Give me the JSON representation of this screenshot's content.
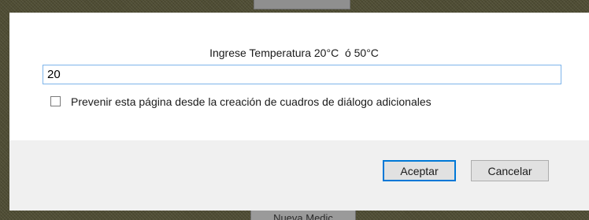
{
  "dialog": {
    "message": "Ingrese Temperatura 20°C  ó 50°C",
    "input_value": "20",
    "checkbox_label": "Prevenir esta página desde la creación de cuadros de diálogo adicionales",
    "checkbox_checked": false,
    "accept_label": "Aceptar",
    "cancel_label": "Cancelar"
  },
  "background": {
    "bottom_tab_label": "Nueva Medic"
  },
  "colors": {
    "page_background": "#4f4d34",
    "input_focus_border": "#7eb4ea",
    "default_button_border": "#0078d7"
  }
}
